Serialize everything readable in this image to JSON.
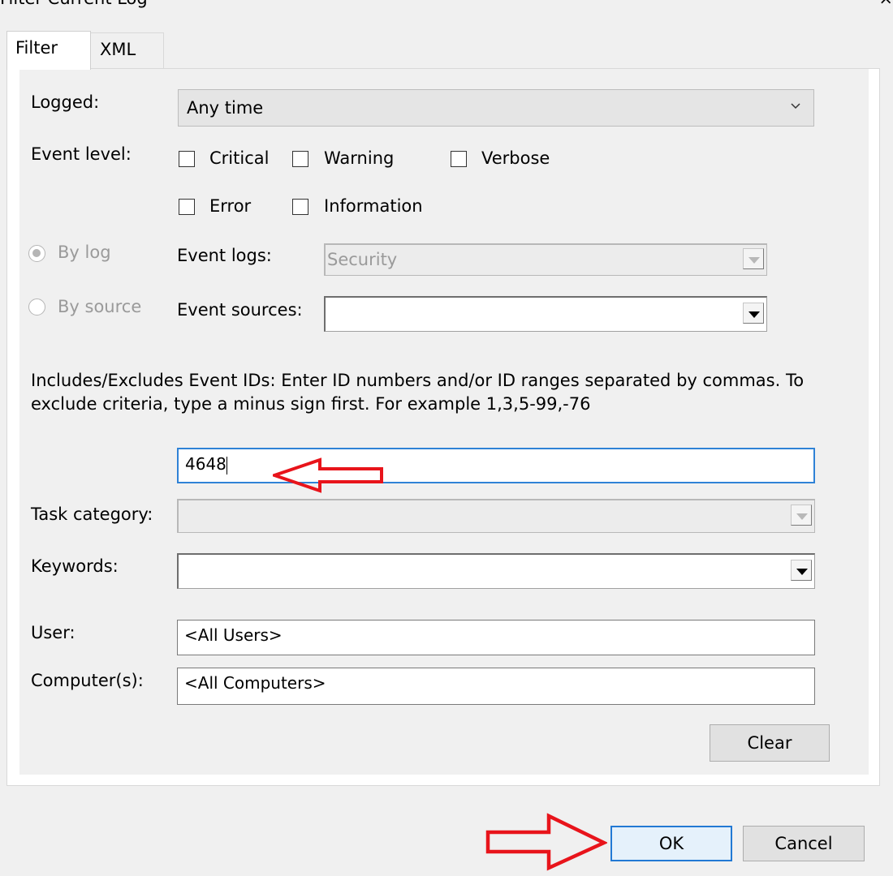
{
  "window": {
    "title": "Filter Current Log",
    "close_fragment": "⨯"
  },
  "tabs": [
    {
      "label": "Filter"
    },
    {
      "label": "XML"
    }
  ],
  "filter": {
    "logged_label": "Logged:",
    "logged_value": "Any time",
    "event_level_label": "Event level:",
    "levels": {
      "critical": "Critical",
      "warning": "Warning",
      "verbose": "Verbose",
      "error": "Error",
      "information": "Information"
    },
    "by_log_label": "By log",
    "by_source_label": "By source",
    "event_logs_label": "Event logs:",
    "event_logs_value": "Security",
    "event_sources_label": "Event sources:",
    "event_sources_value": "",
    "ids_help": "Includes/Excludes Event IDs: Enter ID numbers and/or ID ranges separated by commas. To exclude criteria, type a minus sign first. For example 1,3,5-99,-76",
    "event_ids_value": "4648",
    "task_category_label": "Task category:",
    "task_category_value": "",
    "keywords_label": "Keywords:",
    "keywords_value": "",
    "user_label": "User:",
    "user_value": "<All Users>",
    "computers_label": "Computer(s):",
    "computers_value": "<All Computers>",
    "clear_label": "Clear"
  },
  "footer": {
    "ok_label": "OK",
    "cancel_label": "Cancel"
  },
  "colors": {
    "annotation_arrow": "#e8141b",
    "focus_border": "#2f82d6"
  }
}
